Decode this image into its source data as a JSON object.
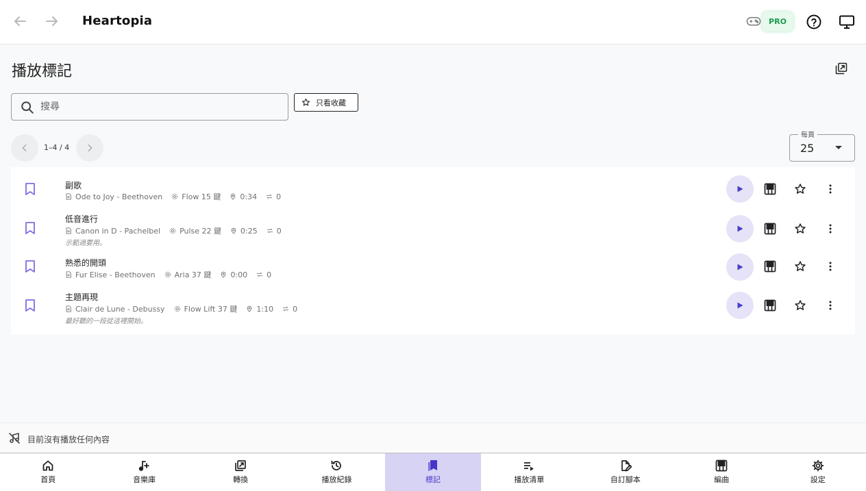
{
  "app": {
    "title": "Heartopia",
    "pro_badge": "PRO"
  },
  "page": {
    "title": "播放標記"
  },
  "search": {
    "placeholder": "搜尋",
    "value": ""
  },
  "filter": {
    "favorites_only_label": "只看收藏"
  },
  "pagination": {
    "range": "1–4 / 4",
    "per_page_label": "每頁",
    "per_page_value": "25"
  },
  "bookmarks": [
    {
      "title": "副歌",
      "song": "Ode to Joy - Beethoven",
      "profile": "Flow 15 鍵",
      "time": "0:34",
      "repeat": "0",
      "note": ""
    },
    {
      "title": "低音進行",
      "song": "Canon in D - Pachelbel",
      "profile": "Pulse 22 鍵",
      "time": "0:25",
      "repeat": "0",
      "note": "示範適要用。"
    },
    {
      "title": "熟悉的開頭",
      "song": "Fur Elise - Beethoven",
      "profile": "Aria 37 鍵",
      "time": "0:00",
      "repeat": "0",
      "note": ""
    },
    {
      "title": "主題再現",
      "song": "Clair de Lune - Debussy",
      "profile": "Flow Lift 37 鍵",
      "time": "1:10",
      "repeat": "0",
      "note": "最好聽的一段從這裡開始。"
    }
  ],
  "now_playing": {
    "text": "目前沒有播放任何內容"
  },
  "bottom_nav": [
    {
      "label": "首頁",
      "icon": "home-icon"
    },
    {
      "label": "音樂庫",
      "icon": "music-add-icon"
    },
    {
      "label": "轉換",
      "icon": "convert-icon"
    },
    {
      "label": "播放紀錄",
      "icon": "history-icon"
    },
    {
      "label": "標記",
      "icon": "bookmarks-icon",
      "active": true
    },
    {
      "label": "播放清單",
      "icon": "playlist-icon"
    },
    {
      "label": "自訂腳本",
      "icon": "script-edit-icon"
    },
    {
      "label": "編曲",
      "icon": "piano-icon"
    },
    {
      "label": "設定",
      "icon": "settings-icon"
    }
  ],
  "colors": {
    "accent": "#4c3fc8",
    "active_nav_bg": "#d7d3f5",
    "pro_green": "#1c9a4a",
    "bookmark": "#7c6fe0"
  }
}
